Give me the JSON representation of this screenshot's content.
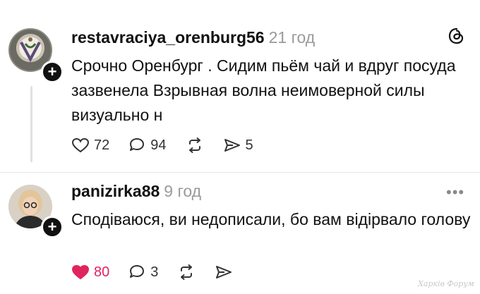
{
  "posts": [
    {
      "username": "restavraciya_orenburg56",
      "time": "21 год",
      "text": "Срочно Оренбург . Сидим пьём чай и вдруг посуда зазвенела Взрывная волна неимоверной силы визуально н",
      "likes": "72",
      "comments": "94",
      "shares": "5"
    },
    {
      "username": "panizirka88",
      "time": "9 год",
      "text": "Сподіваюся, ви недописали, бо вам відірвало голову",
      "likes": "80",
      "comments": "3"
    }
  ],
  "icons": {
    "brand": "threads-logo-icon",
    "more": "more-options-icon",
    "like": "heart-icon",
    "comment": "comment-bubble-icon",
    "repost": "repost-icon",
    "share": "share-send-icon",
    "follow": "follow-plus-icon"
  },
  "colors": {
    "liked": "#e0245e",
    "muted": "#9a9a9a"
  },
  "watermark": "Харків Форум"
}
